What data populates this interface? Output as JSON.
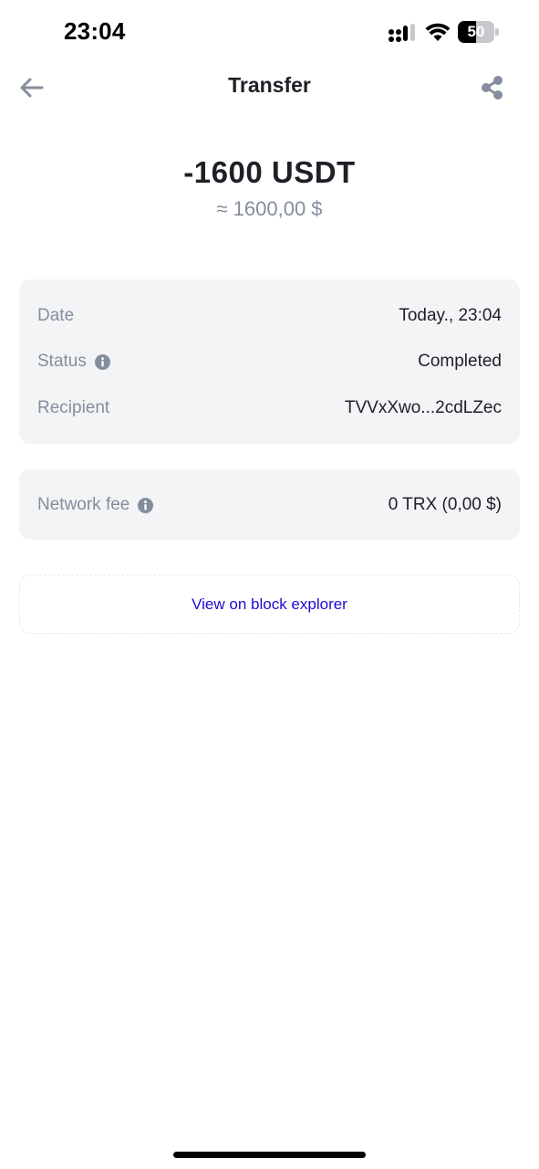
{
  "status_bar": {
    "time": "23:04",
    "battery_level": "50",
    "battery_fraction": 0.5,
    "icons": [
      "signal-icon",
      "wifi-icon",
      "battery-icon"
    ]
  },
  "header": {
    "title": "Transfer",
    "back_icon": "arrow-left-icon",
    "share_icon": "share-icon"
  },
  "amount": {
    "crypto": "-1600 USDT",
    "fiat": "≈ 1600,00 $"
  },
  "details": {
    "date_label": "Date",
    "date_value": "Today., 23:04",
    "status_label": "Status",
    "status_value": "Completed",
    "recipient_label": "Recipient",
    "recipient_value": "TVVxXwo...2cdLZec"
  },
  "fee": {
    "label": "Network fee",
    "value": "0 TRX (0,00 $)"
  },
  "explorer": {
    "label": "View on block explorer"
  },
  "colors": {
    "text_primary": "#1e2026",
    "text_secondary": "#848e9c",
    "card_bg": "#f3f4f6",
    "link": "#1a0dcc"
  }
}
